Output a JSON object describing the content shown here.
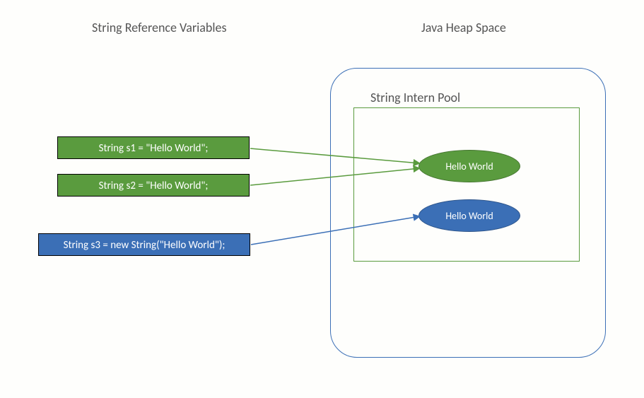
{
  "headings": {
    "left": "String Reference  Variables",
    "right": "Java Heap Space",
    "pool": "String Intern Pool"
  },
  "declarations": {
    "s1": "String s1 = \"Hello World\";",
    "s2": "String s2 = \"Hello World\";",
    "s3": "String s3 = new String(\"Hello World\");"
  },
  "objects": {
    "interned": "Hello World",
    "heap": "Hello World"
  },
  "colors": {
    "green": "#5a9b3e",
    "blue": "#3b6fb6"
  }
}
